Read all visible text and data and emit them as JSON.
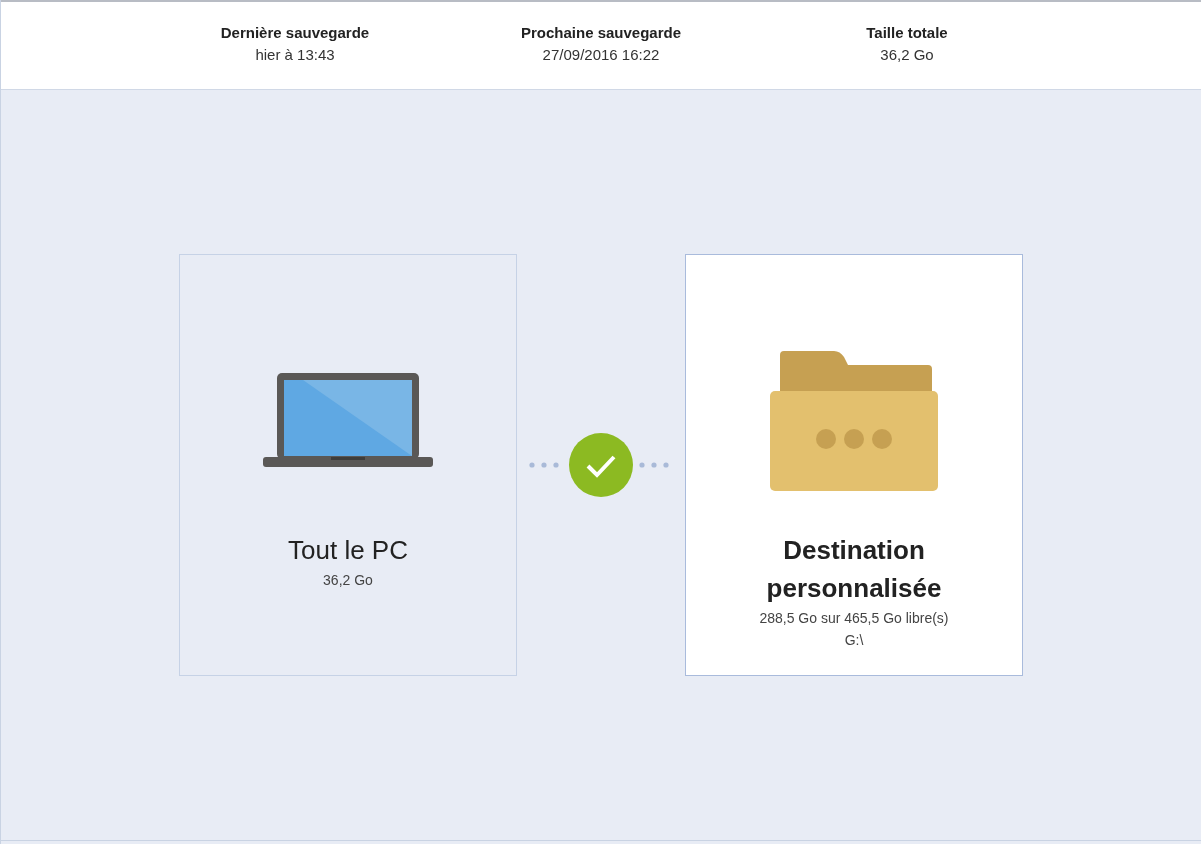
{
  "summary": [
    {
      "label": "Dernière sauvegarde",
      "value": "hier à 13:43"
    },
    {
      "label": "Prochaine sauvegarde",
      "value": "27/09/2016 16:22"
    },
    {
      "label": "Taille totale",
      "value": "36,2 Go"
    }
  ],
  "link_ok": true,
  "cards": [
    {
      "kind": "computer",
      "selected": false,
      "title": "Tout le PC",
      "details": [
        "36,2 Go"
      ]
    },
    {
      "kind": "folder",
      "selected": true,
      "title": "Destination personnalisée",
      "details": [
        "288,5 Go sur 465,5 Go libre(s)",
        "G:\\"
      ]
    }
  ]
}
